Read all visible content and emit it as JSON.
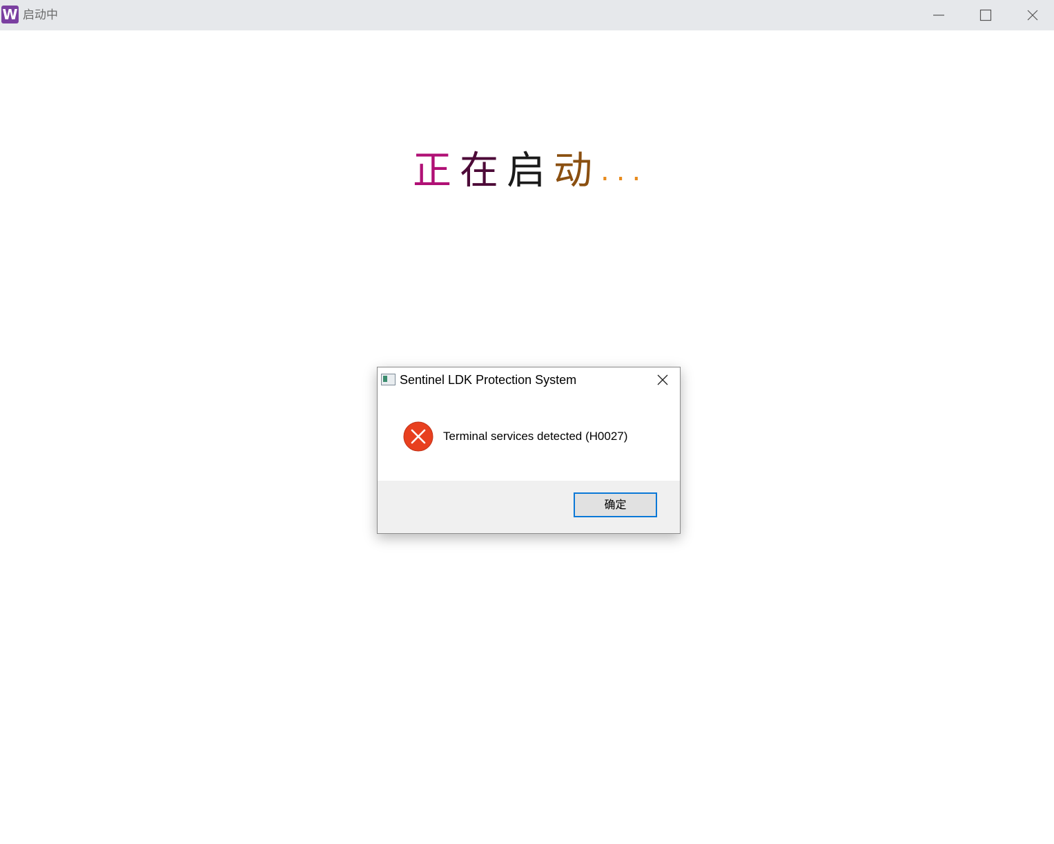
{
  "window": {
    "title": "启动中",
    "app_icon_letter": "W",
    "controls": [
      "minimize",
      "maximize",
      "close"
    ]
  },
  "splash": {
    "chars": [
      "正",
      "在",
      "启",
      "动"
    ],
    "dots": [
      ".",
      ".",
      "."
    ]
  },
  "dialog": {
    "title": "Sentinel LDK Protection System",
    "message": "Terminal services detected (H0027)",
    "ok_label": "确定",
    "icon": "error-icon"
  },
  "colors": {
    "titlebar_bg": "#e6e8eb",
    "splash_char_1": "#b01075",
    "splash_char_2": "#4d0a38",
    "splash_char_3": "#1a1a1a",
    "splash_char_4": "#8a4f10",
    "splash_dots": "#e88a1c",
    "error_red": "#e8401f",
    "button_focus": "#0a78d7"
  }
}
